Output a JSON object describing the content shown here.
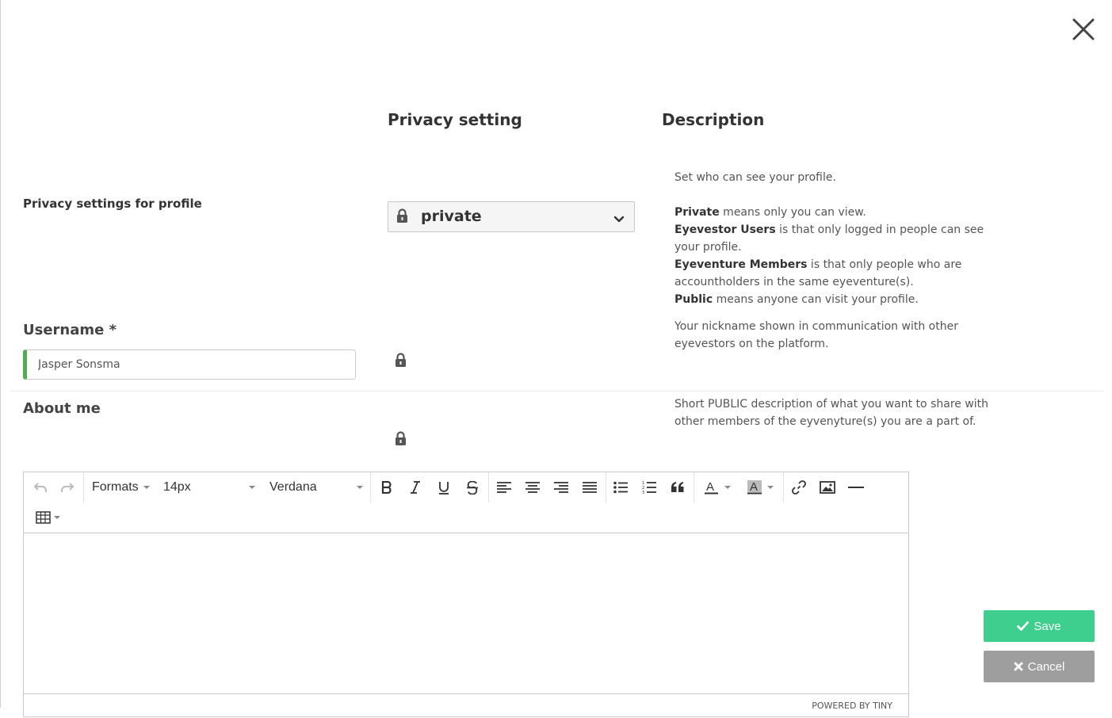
{
  "columns": {
    "privacy_setting": "Privacy setting",
    "description": "Description"
  },
  "privacy_profile": {
    "label": "Privacy settings for profile",
    "selected_value": "private",
    "description_intro": "Set who can see your profile.",
    "options_help": [
      {
        "term": "Private",
        "text": " means only you can view."
      },
      {
        "term": "Eyevestor Users",
        "text": " is that only logged in people can see your profile."
      },
      {
        "term": "Eyeventure Members",
        "text": " is that only people who are accountholders in the same eyeventure(s)."
      },
      {
        "term": "Public",
        "text": " means anyone can visit your profile."
      }
    ]
  },
  "username": {
    "label": "Username *",
    "value": "Jasper Sonsma",
    "description": "Your nickname shown in communication with other eyevestors on the platform."
  },
  "about_me": {
    "label": "About me",
    "description": "Short PUBLIC description of what you want to share with other members of the eyvenyture(s) you are a part of."
  },
  "editor": {
    "formats_label": "Formats",
    "font_size": "14px",
    "font_family": "Verdana",
    "powered_by": "POWERED BY TINY"
  },
  "buttons": {
    "save": "Save",
    "cancel": "Cancel"
  },
  "colors": {
    "save_bg": "#3ecf8e",
    "cancel_bg": "#9e9e9e",
    "input_accent": "#4caf50"
  },
  "icons": [
    "close-icon",
    "lock-icon",
    "chevron-down-icon",
    "undo-icon",
    "redo-icon",
    "bold-icon",
    "italic-icon",
    "underline-icon",
    "strikethrough-icon",
    "align-left-icon",
    "align-center-icon",
    "align-right-icon",
    "align-justify-icon",
    "bullet-list-icon",
    "numbered-list-icon",
    "blockquote-icon",
    "text-color-icon",
    "background-color-icon",
    "link-icon",
    "image-icon",
    "horizontal-rule-icon",
    "table-icon",
    "check-icon",
    "times-icon"
  ]
}
